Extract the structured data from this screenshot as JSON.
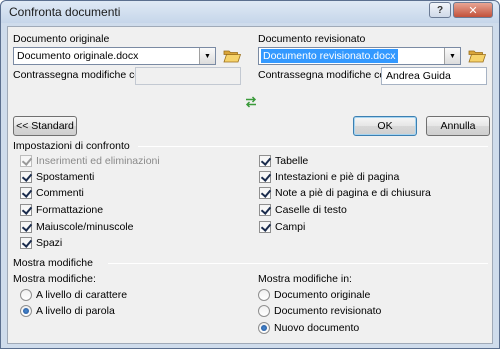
{
  "window": {
    "title": "Confronta documenti",
    "help_label": "?",
    "close_label": "✕"
  },
  "original": {
    "label": "Documento originale",
    "combo_value": "Documento originale.docx",
    "mark_label": "Contrassegna modifiche con",
    "mark_value": ""
  },
  "revised": {
    "label": "Documento revisionato",
    "combo_value": "Documento revisionato.docx",
    "mark_label": "Contrassegna modifiche con",
    "mark_value": "Andrea Guida"
  },
  "icons": {
    "folder": "folder-open-icon",
    "swap": "swap-arrows-icon",
    "dropdown": "chevron-down-icon"
  },
  "buttons": {
    "standard": "<< Standard",
    "ok": "OK",
    "cancel": "Annulla"
  },
  "compare_settings": {
    "heading": "Impostazioni di confronto",
    "left": [
      {
        "label": "Inserimenti ed eliminazioni",
        "checked": true,
        "disabled": true
      },
      {
        "label": "Spostamenti",
        "checked": true
      },
      {
        "label": "Commenti",
        "checked": true
      },
      {
        "label": "Formattazione",
        "checked": true
      },
      {
        "label": "Maiuscole/minuscole",
        "checked": true
      },
      {
        "label": "Spazi",
        "checked": true
      }
    ],
    "right": [
      {
        "label": "Tabelle",
        "checked": true
      },
      {
        "label": "Intestazioni e piè di pagina",
        "checked": true
      },
      {
        "label": "Note a piè di pagina e di chiusura",
        "checked": true
      },
      {
        "label": "Caselle di testo",
        "checked": true
      },
      {
        "label": "Campi",
        "checked": true
      }
    ]
  },
  "show_changes": {
    "heading": "Mostra modifiche",
    "level_label": "Mostra modifiche:",
    "level_options": [
      {
        "label": "A livello di carattere",
        "selected": false
      },
      {
        "label": "A livello di parola",
        "selected": true
      }
    ],
    "in_label": "Mostra modifiche in:",
    "in_options": [
      {
        "label": "Documento originale",
        "selected": false
      },
      {
        "label": "Documento revisionato",
        "selected": false
      },
      {
        "label": "Nuovo documento",
        "selected": true
      }
    ]
  },
  "colors": {
    "selection": "#3399ff",
    "swap_icon": "#3a9a3a"
  }
}
